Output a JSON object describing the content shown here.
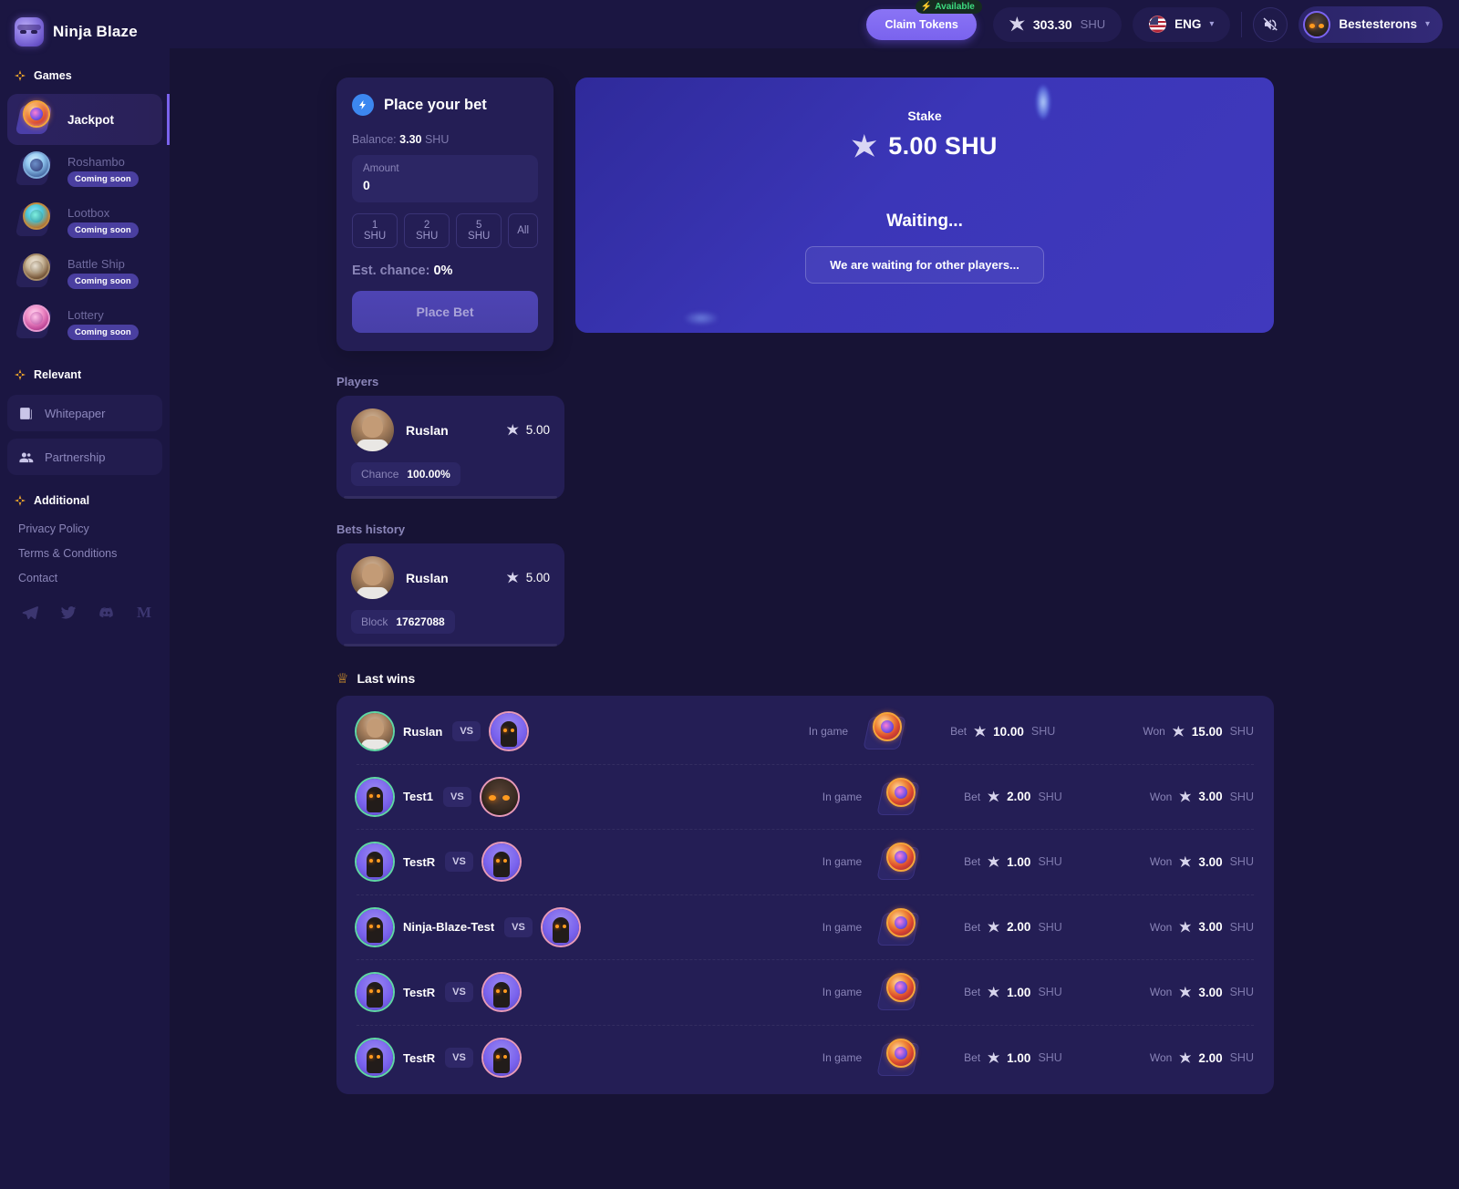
{
  "brand": {
    "name": "Ninja Blaze",
    "logo_icon": "ninja-logo-icon"
  },
  "sidebar": {
    "sections": {
      "games": "Games",
      "relevant": "Relevant",
      "additional": "Additional"
    },
    "games": [
      {
        "label": "Jackpot",
        "badge": "",
        "active": true
      },
      {
        "label": "Roshambo",
        "badge": "Coming soon",
        "active": false
      },
      {
        "label": "Lootbox",
        "badge": "Coming soon",
        "active": false
      },
      {
        "label": "Battle Ship",
        "badge": "Coming soon",
        "active": false
      },
      {
        "label": "Lottery",
        "badge": "Coming soon",
        "active": false
      }
    ],
    "relevant": [
      {
        "label": "Whitepaper",
        "icon": "document-icon"
      },
      {
        "label": "Partnership",
        "icon": "people-icon"
      }
    ],
    "additional": [
      {
        "label": "Privacy Policy"
      },
      {
        "label": "Terms & Conditions"
      },
      {
        "label": "Contact"
      }
    ],
    "socials": [
      {
        "icon": "telegram-icon"
      },
      {
        "icon": "twitter-icon"
      },
      {
        "icon": "discord-icon"
      },
      {
        "icon": "medium-icon",
        "glyph": "M"
      }
    ]
  },
  "header": {
    "claim_button": "Claim Tokens",
    "available_badge": "Available",
    "balance_amount": "303.30",
    "balance_unit": "SHU",
    "language": "ENG",
    "mute_icon": "sound-muted-icon",
    "user_name": "Bestesterons",
    "chevron": "⌄"
  },
  "bet_panel": {
    "title": "Place your bet",
    "icon": "bolt-icon",
    "balance_prefix": "Balance:",
    "balance_value": "3.30",
    "balance_unit": "SHU",
    "amount_label": "Amount",
    "amount_value": "0",
    "quick_bets": [
      "1 SHU",
      "2 SHU",
      "5 SHU",
      "All"
    ],
    "est_chance_label": "Est. chance:",
    "est_chance_value": "0%",
    "place_bet_label": "Place Bet"
  },
  "stake_panel": {
    "stake_label": "Stake",
    "stake_value": "5.00 SHU",
    "status_title": "Waiting...",
    "status_message": "We are waiting for other players..."
  },
  "players": {
    "title": "Players",
    "rows": [
      {
        "name": "Ruslan",
        "amount": "5.00",
        "tag_key": "Chance",
        "tag_value": "100.00%"
      }
    ]
  },
  "bets_history": {
    "title": "Bets history",
    "rows": [
      {
        "name": "Ruslan",
        "amount": "5.00",
        "tag_key": "Block",
        "tag_value": "17627088"
      }
    ]
  },
  "last_wins": {
    "title": "Last wins",
    "icon": "crown-icon",
    "vs_label": "VS",
    "status_label": "In game",
    "bet_label": "Bet",
    "won_label": "Won",
    "unit": "SHU",
    "rows": [
      {
        "player": "Ruslan",
        "avatar": "photo",
        "opponent_avatar": "ninja",
        "bet": "10.00",
        "won": "15.00"
      },
      {
        "player": "Test1",
        "avatar": "ninja",
        "opponent_avatar": "bigface",
        "bet": "2.00",
        "won": "3.00"
      },
      {
        "player": "TestR",
        "avatar": "ninja",
        "opponent_avatar": "ninja",
        "bet": "1.00",
        "won": "3.00"
      },
      {
        "player": "Ninja-Blaze-Test",
        "avatar": "ninja",
        "opponent_avatar": "ninja",
        "bet": "2.00",
        "won": "3.00"
      },
      {
        "player": "TestR",
        "avatar": "ninja",
        "opponent_avatar": "ninja",
        "bet": "1.00",
        "won": "3.00"
      },
      {
        "player": "TestR",
        "avatar": "ninja",
        "opponent_avatar": "ninja",
        "bet": "1.00",
        "won": "2.00"
      }
    ]
  },
  "colors": {
    "bg": "#171335",
    "sidebar": "#1b1642",
    "card": "#241e55",
    "accent": "#7a63ee",
    "accent_blue": "#3c87f0",
    "gold": "#f0a62a",
    "green": "#3ddc7f",
    "muted": "#8a85b8"
  }
}
